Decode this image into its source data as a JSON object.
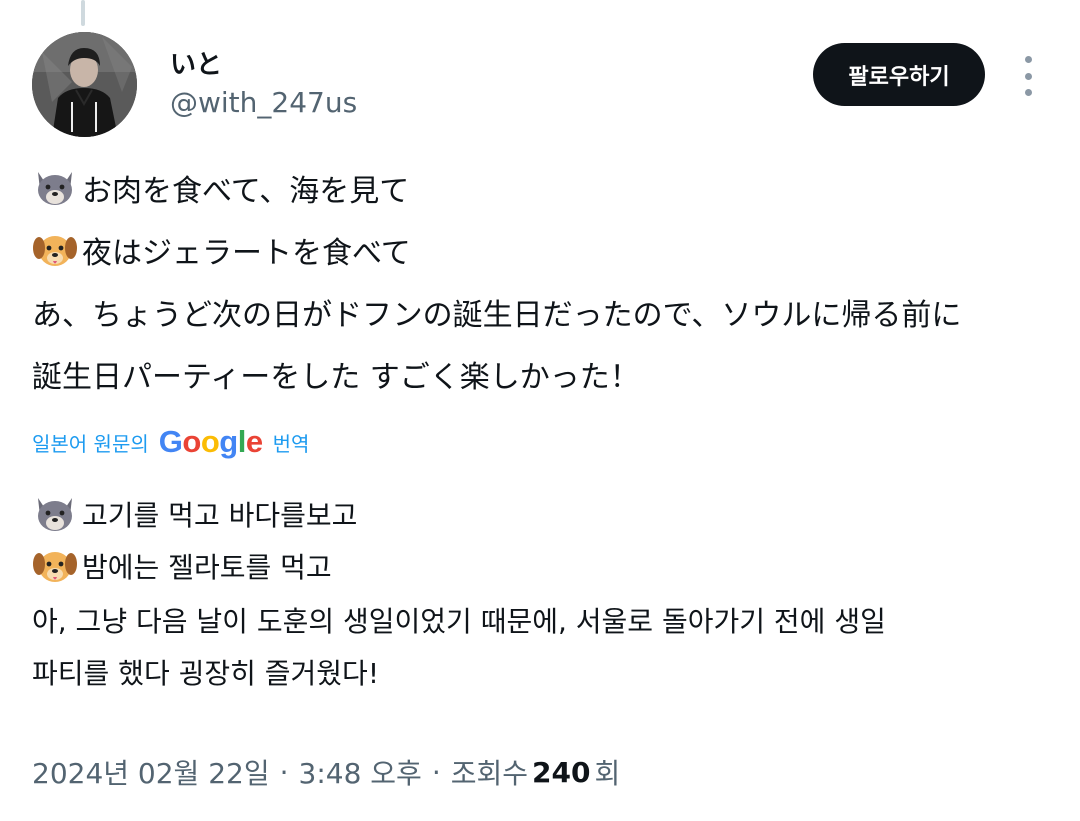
{
  "user": {
    "display_name": "いと",
    "handle": "@with_247us"
  },
  "follow_button": {
    "label": "팔로우하기"
  },
  "tweet": {
    "original_lines": [
      {
        "emoji": "wolf-emoji",
        "text": "お肉を食べて、海を見て"
      },
      {
        "emoji": "dog-emoji",
        "text": "夜はジェラートを食べて"
      },
      {
        "emoji": "",
        "text": "あ、ちょうど次の日がドフンの誕生日だったので、ソウルに帰る前に"
      },
      {
        "emoji": "",
        "text": "誕生日パーティーをした すごく楽しかった！"
      }
    ],
    "translation_label_prefix": "일본어 원문의",
    "translation_provider": "Google",
    "translation_label_suffix": "번역",
    "translated_lines": [
      {
        "emoji": "wolf-emoji",
        "text": "고기를 먹고 바다를보고"
      },
      {
        "emoji": "dog-emoji",
        "text": "밤에는 젤라토를 먹고"
      },
      {
        "emoji": "",
        "text": "아, 그냥 다음 날이 도훈의 생일이었기 때문에, 서울로 돌아가기 전에 생일"
      },
      {
        "emoji": "",
        "text": "파티를 했다 굉장히 즐거웠다!"
      }
    ]
  },
  "meta": {
    "date": "2024년 02월 22일",
    "separator": "·",
    "time": "3:48 오후",
    "views_label": "조회수",
    "views_count": "240",
    "views_suffix": "회"
  },
  "colors": {
    "text_primary": "#0f1419",
    "text_secondary": "#536471",
    "link_blue": "#1d9bf0",
    "button_bg": "#0f1419"
  }
}
